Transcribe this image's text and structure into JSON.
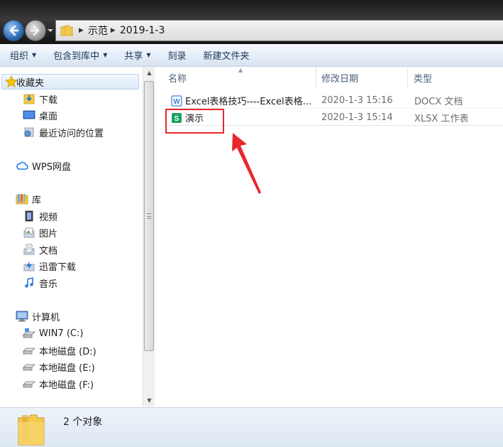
{
  "address": {
    "crumbs": [
      "示范",
      "2019-1-3"
    ]
  },
  "toolbar": {
    "organize": "组织",
    "include_in_library": "包含到库中",
    "share": "共享",
    "burn": "刻录",
    "new_folder": "新建文件夹"
  },
  "nav": {
    "favorites": "收藏夹",
    "downloads": "下载",
    "desktop": "桌面",
    "recent": "最近访问的位置",
    "wps": "WPS网盘",
    "libraries": "库",
    "videos": "视频",
    "pictures": "图片",
    "documents": "文档",
    "thunder": "迅雷下载",
    "music": "音乐",
    "computer": "计算机",
    "drive_c": "WIN7 (C:)",
    "drive_d": "本地磁盘 (D:)",
    "drive_e": "本地磁盘 (E:)",
    "drive_f": "本地磁盘 (F:)"
  },
  "columns": {
    "name": "名称",
    "date": "修改日期",
    "type": "类型"
  },
  "files": [
    {
      "name": "Excel表格技巧----Excel表格...",
      "date": "2020-1-3 15:16",
      "type": "DOCX 文档",
      "icon": "wps-writer-icon",
      "icon_letter": "W"
    },
    {
      "name": "演示",
      "date": "2020-1-3 15:14",
      "type": "XLSX 工作表",
      "icon": "wps-spreadsheet-icon",
      "icon_letter": "S"
    }
  ],
  "status": {
    "count": "2 个对象"
  },
  "colors": {
    "highlight": "#e8272d",
    "writer_blue": "#3d7fd8",
    "sheet_green": "#1aa260"
  }
}
